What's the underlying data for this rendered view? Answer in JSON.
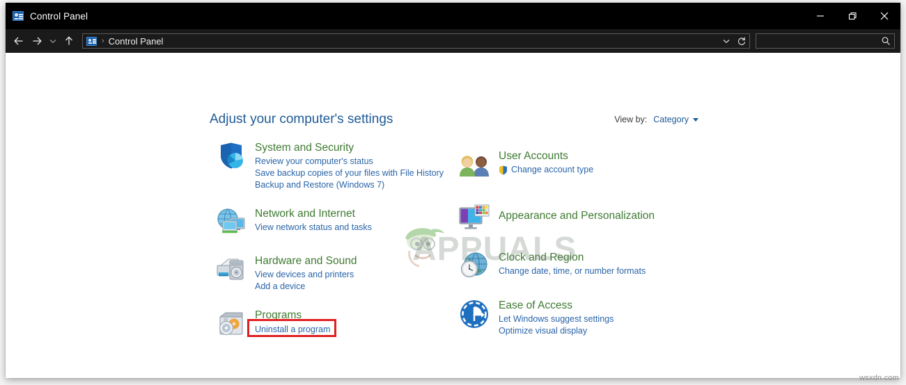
{
  "window": {
    "title": "Control Panel",
    "title_icon": "control-panel-icon",
    "controls": {
      "minimize": "minimize-icon",
      "maximize": "restore-icon",
      "close": "close-icon"
    }
  },
  "navbar": {
    "back": "back-arrow-icon",
    "forward": "forward-arrow-icon",
    "recent": "chevron-down-icon",
    "up": "up-arrow-icon",
    "breadcrumb_icon": "control-panel-icon",
    "breadcrumb_separator": "›",
    "breadcrumb": "Control Panel",
    "dropdown": "chevron-down-icon",
    "refresh": "refresh-icon",
    "search": {
      "value": "",
      "placeholder": "",
      "icon": "search-icon"
    }
  },
  "main": {
    "heading": "Adjust your computer's settings",
    "view_by": {
      "label": "View by:",
      "value": "Category",
      "caret": "chevron-down-icon"
    }
  },
  "categories": {
    "left": [
      {
        "title": "System and Security",
        "icon": "shield-icon",
        "links": [
          "Review your computer's status",
          "Save backup copies of your files with File History",
          "Backup and Restore (Windows 7)"
        ]
      },
      {
        "title": "Network and Internet",
        "icon": "globe-monitors-icon",
        "links": [
          "View network status and tasks"
        ]
      },
      {
        "title": "Hardware and Sound",
        "icon": "printer-speaker-icon",
        "links": [
          "View devices and printers",
          "Add a device"
        ]
      },
      {
        "title": "Programs",
        "icon": "programs-disc-icon",
        "links": [
          "Uninstall a program"
        ],
        "highlighted_link": "Uninstall a program"
      }
    ],
    "right": [
      {
        "title": "User Accounts",
        "icon": "user-accounts-icon",
        "links": [
          "Change account type"
        ],
        "link_icon": "uac-shield-icon"
      },
      {
        "title": "Appearance and Personalization",
        "icon": "appearance-monitor-icon",
        "links": []
      },
      {
        "title": "Clock and Region",
        "icon": "clock-globe-icon",
        "links": [
          "Change date, time, or number formats"
        ]
      },
      {
        "title": "Ease of Access",
        "icon": "ease-of-access-icon",
        "links": [
          "Let Windows suggest settings",
          "Optimize visual display"
        ]
      }
    ]
  },
  "watermarks": {
    "center": "APPUALS",
    "corner": "wsxdn.com"
  },
  "colors": {
    "titlebar_bg": "#000000",
    "navbar_bg": "#1a1a1a",
    "category_title": "#3e7a31",
    "link": "#2964a8",
    "heading": "#1e5a96",
    "highlight": "#e02020"
  }
}
